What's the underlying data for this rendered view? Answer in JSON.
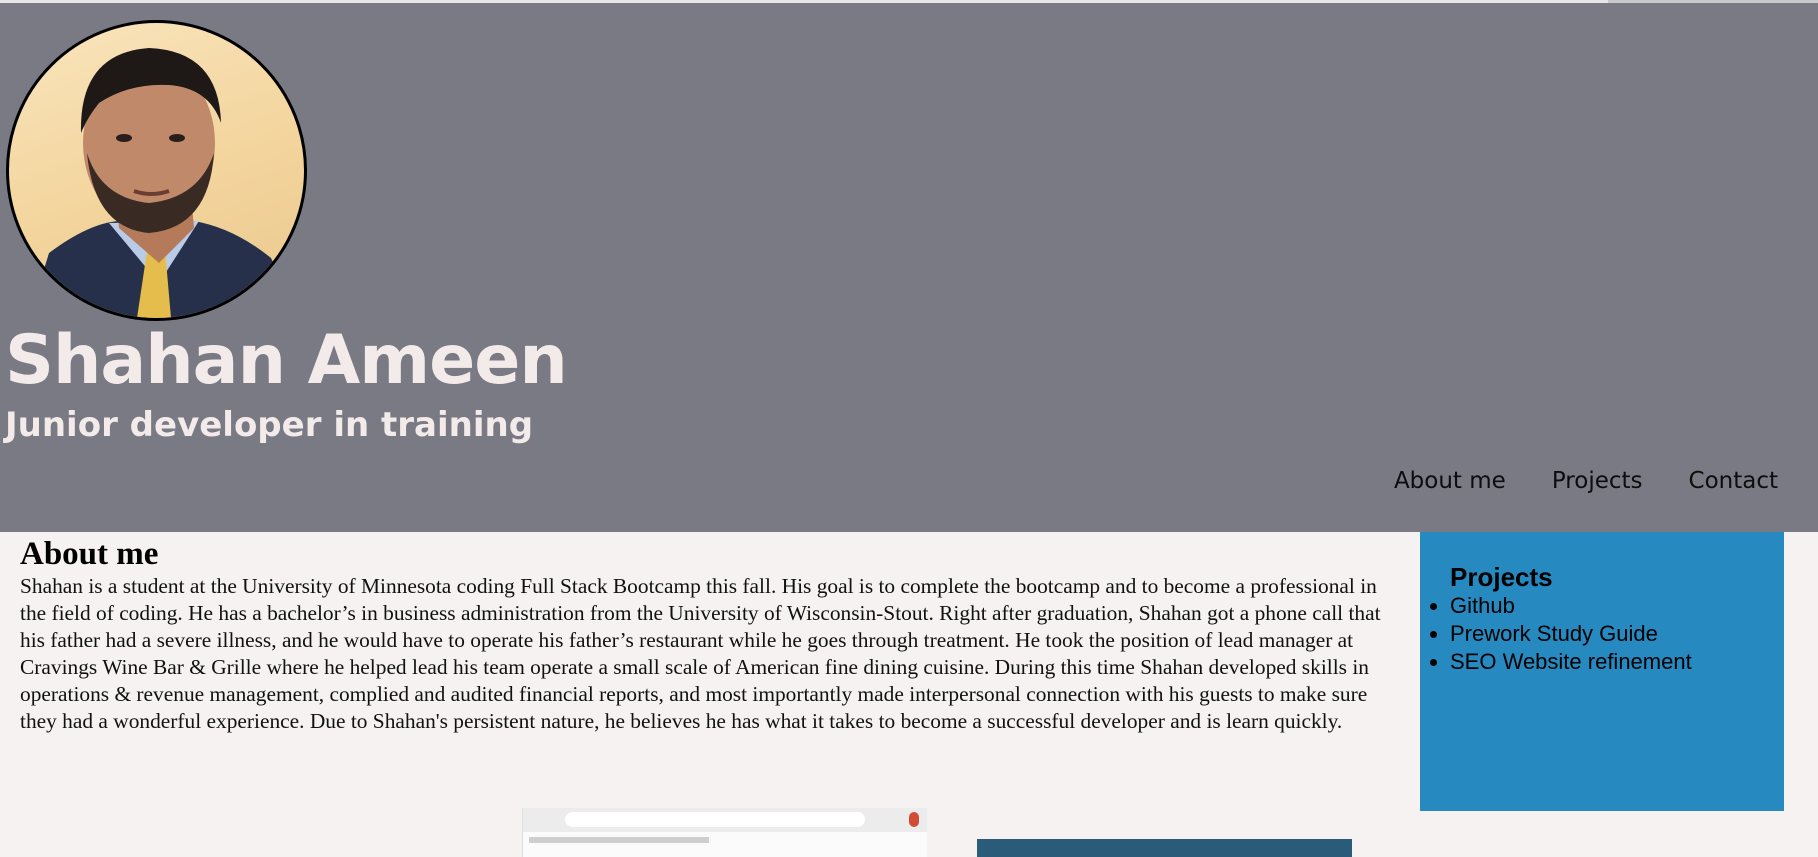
{
  "header": {
    "name": "Shahan Ameen",
    "subtitle": "Junior developer in training",
    "nav": [
      {
        "label": "About me"
      },
      {
        "label": "Projects"
      },
      {
        "label": "Contact"
      }
    ]
  },
  "about": {
    "heading": "About me",
    "body": "Shahan is a student at the University of Minnesota coding Full Stack Bootcamp this fall. His goal is to complete the bootcamp and to become a professional in the field of coding. He has a bachelor’s in business administration from the University of Wisconsin-Stout. Right after graduation, Shahan got a phone call that his father had a severe illness, and he would have to operate his father’s restaurant while he goes through treatment. He took the position of lead manager at Cravings Wine Bar & Grille where he helped lead his team operate a small scale of American fine dining cuisine. During this time Shahan developed skills in operations & revenue management, complied and audited financial reports, and most importantly made interpersonal connection with his guests to make sure they had a wonderful experience. Due to Shahan's persistent nature, he believes he has what it takes to become a successful developer and is learn quickly."
  },
  "sidebar": {
    "heading": "Projects",
    "links": [
      {
        "label": "Github"
      },
      {
        "label": "Prework Study Guide"
      },
      {
        "label": "SEO Website refinement"
      }
    ]
  },
  "colors": {
    "header_bg": "#797a83",
    "page_bg": "#f5f2f1",
    "sidebar_bg": "#2689c0",
    "title_text": "#f3eaea"
  }
}
